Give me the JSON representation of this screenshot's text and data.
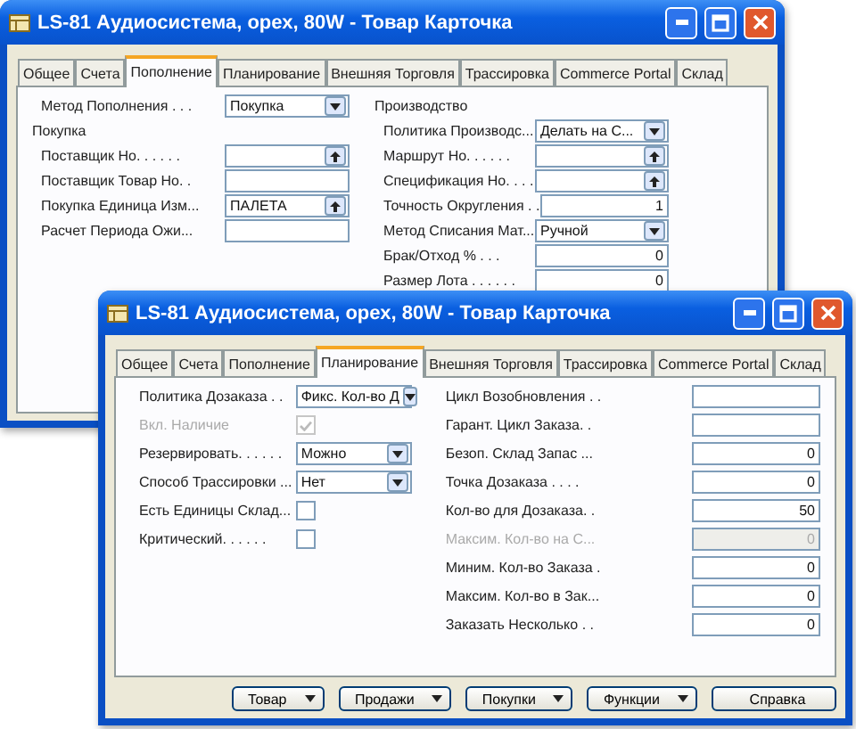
{
  "windows": [
    {
      "title": "LS-81 Аудиосистема, орех, 80W - Товар Карточка",
      "tabs": [
        {
          "label": "Общее",
          "selected": false
        },
        {
          "label": "Счета",
          "selected": false
        },
        {
          "label": "Пополнение",
          "selected": true
        },
        {
          "label": "Планирование",
          "selected": false
        },
        {
          "label": "Внешняя Торговля",
          "selected": false
        },
        {
          "label": "Трассировка",
          "selected": false
        },
        {
          "label": "Commerce Portal",
          "selected": false
        },
        {
          "label": "Склад",
          "selected": false
        }
      ],
      "columns": [
        [
          {
            "kind": "dropdown",
            "label": "Метод Пополнения . . .",
            "value": "Покупка",
            "disabled": false
          },
          {
            "kind": "section",
            "label": "Покупка"
          },
          {
            "kind": "lookup",
            "label": "Поставщик Но. . . . . .",
            "disabled": false
          },
          {
            "kind": "text",
            "label": "Поставщик Товар Но. .",
            "disabled": false
          },
          {
            "kind": "lookup",
            "label": "Покупка Единица Изм...",
            "value": "ПАЛЕТА",
            "disabled": false
          },
          {
            "kind": "text",
            "label": "Расчет Периода Ожи...",
            "disabled": false
          }
        ],
        [
          {
            "kind": "section",
            "label": "Производство"
          },
          {
            "kind": "dropdown",
            "label": "Политика Производс...",
            "value": "Делать на С...",
            "disabled": false
          },
          {
            "kind": "lookup",
            "label": "Маршрут Но. . . . . .",
            "disabled": false
          },
          {
            "kind": "lookup",
            "label": "Спецификация Но. . . .",
            "disabled": false
          },
          {
            "kind": "number",
            "label": "Точность Округления . .",
            "value": "1",
            "disabled": false
          },
          {
            "kind": "dropdown",
            "label": "Метод Списания Мат...",
            "value": "Ручной",
            "disabled": false
          },
          {
            "kind": "number",
            "label": "Брак/Отход % . . .",
            "value": "0",
            "disabled": false
          },
          {
            "kind": "number",
            "label": "Размер Лота . . . . . .",
            "value": "0",
            "disabled": false
          }
        ]
      ]
    },
    {
      "title": "LS-81 Аудиосистема, орех, 80W - Товар Карточка",
      "tabs": [
        {
          "label": "Общее",
          "selected": false
        },
        {
          "label": "Счета",
          "selected": false
        },
        {
          "label": "Пополнение",
          "selected": false
        },
        {
          "label": "Планирование",
          "selected": true
        },
        {
          "label": "Внешняя Торговля",
          "selected": false
        },
        {
          "label": "Трассировка",
          "selected": false
        },
        {
          "label": "Commerce Portal",
          "selected": false
        },
        {
          "label": "Склад",
          "selected": false
        }
      ],
      "columns": [
        [
          {
            "kind": "dropdown",
            "label": "Политика Дозаказа . .",
            "value": "Фикс. Кол-во Д",
            "disabled": false
          },
          {
            "kind": "checkbox",
            "label": "Вкл. Наличие",
            "checked": true,
            "disabled": true
          },
          {
            "kind": "dropdown",
            "label": "Резервировать. . . . . .",
            "value": "Можно",
            "disabled": false
          },
          {
            "kind": "dropdown",
            "label": "Способ Трассировки ...",
            "value": "Нет",
            "disabled": false
          },
          {
            "kind": "checkbox",
            "label": "Есть Единицы Склад...",
            "checked": false,
            "disabled": false
          },
          {
            "kind": "checkbox",
            "label": "Критический. . . . . .",
            "checked": false,
            "disabled": false
          }
        ],
        [
          {
            "kind": "text",
            "label": "Цикл Возобновления . .",
            "disabled": false
          },
          {
            "kind": "text",
            "label": "Гарант. Цикл Заказа. .",
            "disabled": false
          },
          {
            "kind": "number",
            "label": "Безоп. Склад Запас ...",
            "value": "0",
            "disabled": false
          },
          {
            "kind": "number",
            "label": "Точка Дозаказа . . . .",
            "value": "0",
            "disabled": false
          },
          {
            "kind": "number",
            "label": "Кол-во для Дозаказа. .",
            "value": "50",
            "disabled": false
          },
          {
            "kind": "number",
            "label": "Максим. Кол-во на С...",
            "value": "0",
            "disabled": true
          },
          {
            "kind": "number",
            "label": "Миним. Кол-во Заказа .",
            "value": "0",
            "disabled": false
          },
          {
            "kind": "number",
            "label": "Максим. Кол-во в Зак...",
            "value": "0",
            "disabled": false
          },
          {
            "kind": "number",
            "label": "Заказать Несколько . .",
            "value": "0",
            "disabled": false
          }
        ]
      ],
      "buttons": [
        {
          "label": "Товар",
          "menu": true
        },
        {
          "label": "Продажи",
          "menu": true
        },
        {
          "label": "Покупки",
          "menu": true
        },
        {
          "label": "Функции",
          "menu": true
        },
        {
          "label": "Справка",
          "menu": false
        }
      ]
    }
  ]
}
